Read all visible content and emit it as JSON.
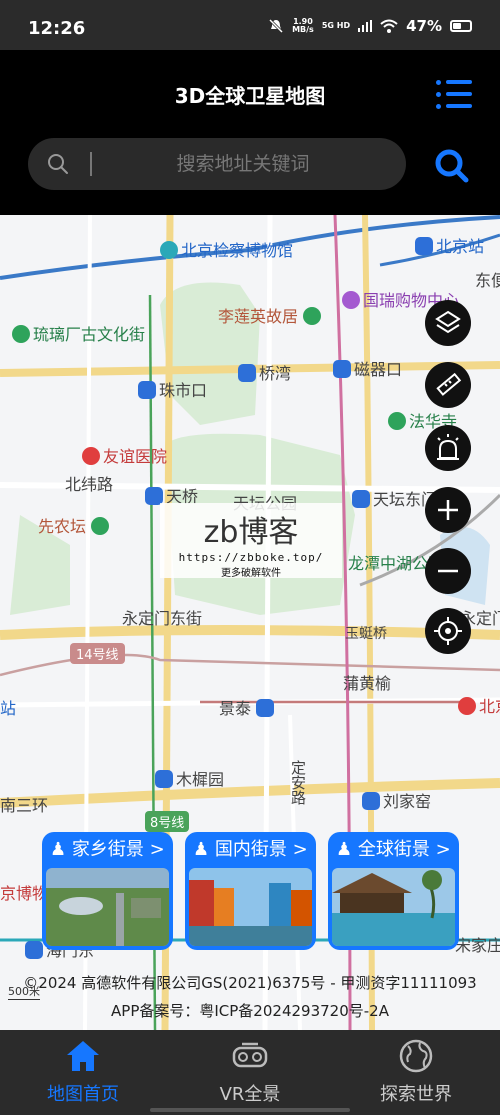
{
  "status": {
    "time": "12:26",
    "speed": "1.90",
    "speed_unit": "MB/s",
    "network": "5G HD",
    "battery": "47%"
  },
  "header": {
    "title": "3D全球卫星地图",
    "search_placeholder": "搜索地址关键词"
  },
  "map": {
    "pois": [
      "北京检察博物馆",
      "北京站",
      "东便",
      "李莲英故居",
      "国瑞购物中心",
      "琉璃厂古文化街",
      "桥湾",
      "磁器口",
      "珠市口",
      "法华寺",
      "友谊医院",
      "北纬路",
      "天桥",
      "天坛公园",
      "天坛东门",
      "先农坛",
      "龙潭中湖公园",
      "永定门东街",
      "14号线",
      "玉蜓桥",
      "蒲黄榆",
      "景泰",
      "站",
      "木樨园",
      "定安路",
      "南三环",
      "刘家窑",
      "8号线",
      "京博物",
      "海门东",
      "宋家庄",
      "北京东",
      "永定门南"
    ],
    "watermark": {
      "title": "zb博客",
      "url": "https://zbboke.top/",
      "note": "更多破解软件"
    },
    "scale_label": "500米",
    "copyright": "©2024 高德软件有限公司GS(2021)6375号 - 甲测资字11111093",
    "icp": "APP备案号：粤ICP备2024293720号-2A"
  },
  "street_views": [
    {
      "label": "家乡街景 >"
    },
    {
      "label": "国内街景 >"
    },
    {
      "label": "全球街景 >"
    }
  ],
  "controls": [
    "layers-icon",
    "ruler-icon",
    "alarm-icon",
    "zoom-in-icon",
    "zoom-out-icon",
    "locate-icon"
  ],
  "tabs": [
    {
      "label": "地图首页",
      "active": true
    },
    {
      "label": "VR全景",
      "active": false
    },
    {
      "label": "探索世界",
      "active": false
    }
  ],
  "colors": {
    "accent": "#1677ff",
    "header_bg": "#000000",
    "tabbar_bg": "#2b2b2b"
  }
}
